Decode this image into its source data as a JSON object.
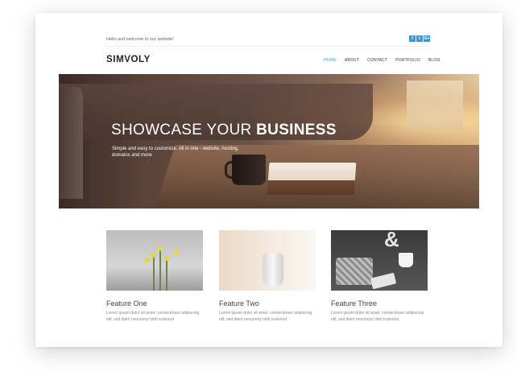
{
  "topbar": {
    "welcome": "Hello and welcome to our website!",
    "socials": [
      {
        "icon": "facebook-icon",
        "glyph": "f"
      },
      {
        "icon": "twitter-icon",
        "glyph": "t"
      },
      {
        "icon": "googleplus-icon",
        "glyph": "G+"
      }
    ]
  },
  "header": {
    "logo": "SIMVOLY",
    "nav": [
      {
        "label": "HOME",
        "active": true
      },
      {
        "label": "ABOUT",
        "active": false
      },
      {
        "label": "CONTACT",
        "active": false
      },
      {
        "label": "PORTFOLIO",
        "active": false
      },
      {
        "label": "BLOG",
        "active": false
      }
    ]
  },
  "hero": {
    "title_regular": "SHOWCASE YOUR ",
    "title_bold": "BUSINESS",
    "subtitle": "Simple and easy to customize. All in one - website, hosting, domains and more"
  },
  "features": [
    {
      "title": "Feature One",
      "text": "Lorem ipsum dolor sit amet, consectetuer adipiscing elit, sed diam nonummy nibh euismod"
    },
    {
      "title": "Feature Two",
      "text": "Lorem ipsum dolor sit amet, consectetuer adipiscing elit, sed diam nonummy nibh euismod"
    },
    {
      "title": "Feature Three",
      "text": "Lorem ipsum dolor sit amet, consectetuer adipiscing elit, sed diam nonummy nibh euismod"
    }
  ],
  "colors": {
    "accent": "#3a9ad9",
    "text": "#444444"
  }
}
